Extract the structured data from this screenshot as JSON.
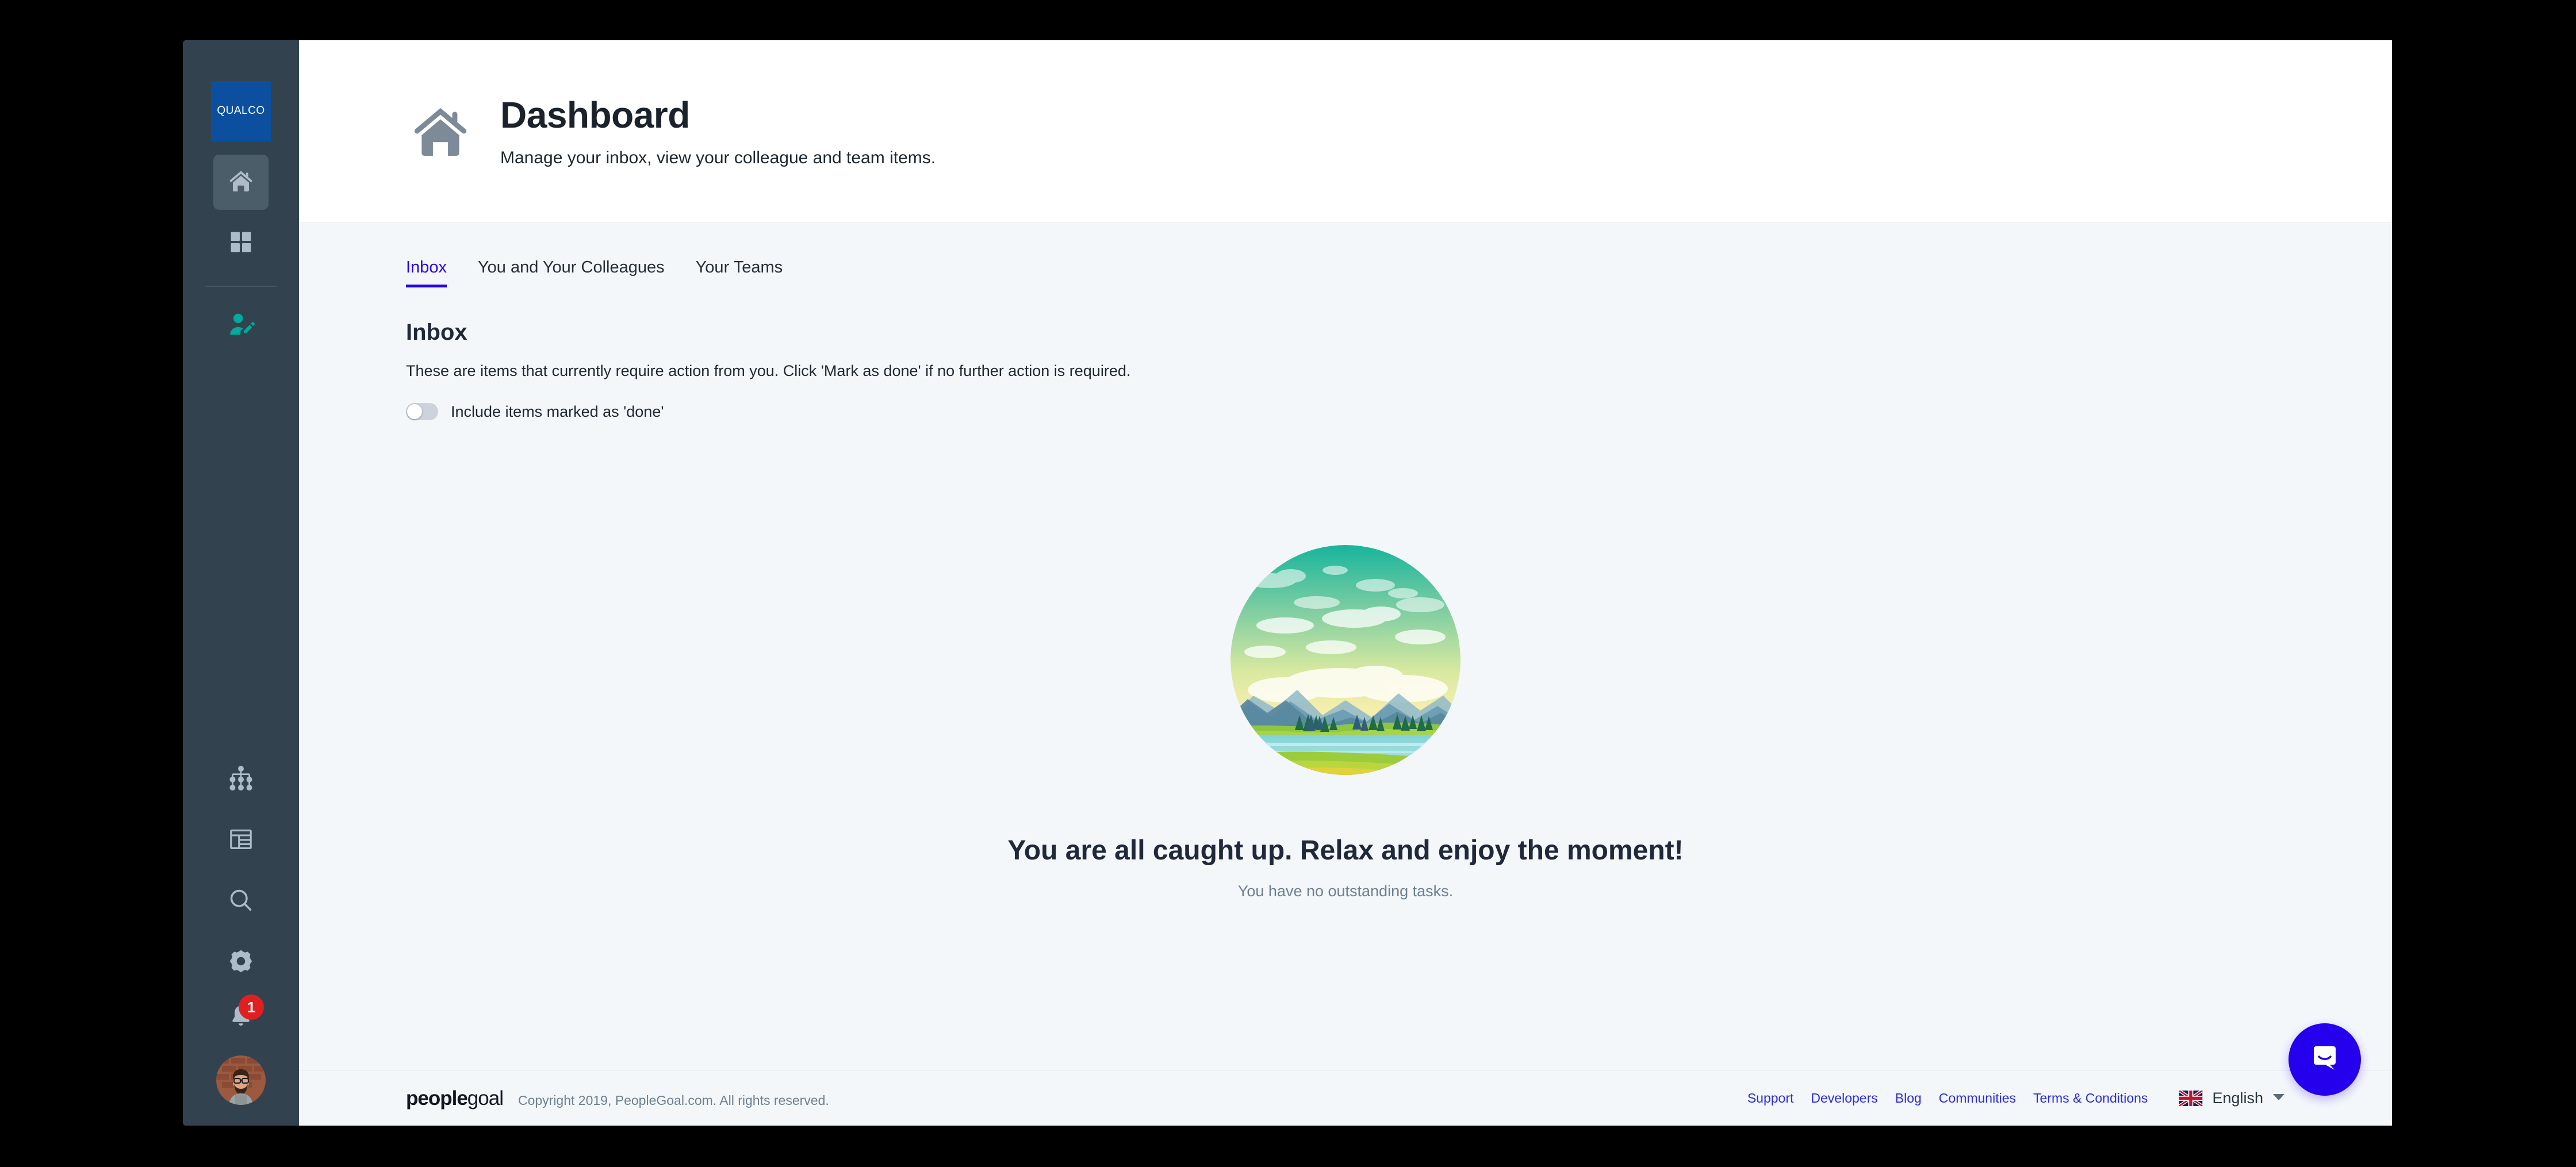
{
  "sidebar": {
    "brand": "QUALCO",
    "items": [
      {
        "name": "home",
        "icon": "home-icon",
        "active": true
      },
      {
        "name": "apps",
        "icon": "grid-icon",
        "active": false
      },
      {
        "name": "profile-edit",
        "icon": "user-edit-icon",
        "active": false
      },
      {
        "name": "org-chart",
        "icon": "org-chart-icon",
        "active": false
      },
      {
        "name": "reports",
        "icon": "table-icon",
        "active": false
      },
      {
        "name": "search",
        "icon": "search-icon",
        "active": false
      },
      {
        "name": "settings",
        "icon": "gear-icon",
        "active": false
      }
    ],
    "notifications": {
      "icon": "bell-icon",
      "count": "1"
    },
    "avatar": {
      "icon": "avatar"
    }
  },
  "header": {
    "icon": "home-icon",
    "title": "Dashboard",
    "subtitle": "Manage your inbox, view your colleague and team items."
  },
  "tabs": [
    {
      "label": "Inbox",
      "active": true
    },
    {
      "label": "You and Your Colleagues",
      "active": false
    },
    {
      "label": "Your Teams",
      "active": false
    }
  ],
  "inbox": {
    "title": "Inbox",
    "description": "These are items that currently require action from you. Click 'Mark as done' if no further action is required.",
    "toggle": {
      "label": "Include items marked as 'done'",
      "checked": false
    }
  },
  "empty_state": {
    "illustration": "landscape-illustration",
    "title": "You are all caught up. Relax and enjoy the moment!",
    "subtitle": "You have no outstanding tasks."
  },
  "footer": {
    "logo_bold": "people",
    "logo_light": "goal",
    "copyright": "Copyright 2019, PeopleGoal.com. All rights reserved.",
    "links": [
      "Support",
      "Developers",
      "Blog",
      "Communities",
      "Terms & Conditions"
    ],
    "language": {
      "flag": "uk-flag-icon",
      "label": "English",
      "chevron": "chevron-down-icon"
    }
  },
  "chat_widget": {
    "icon": "intercom-chat-icon"
  },
  "colors": {
    "sidebar_bg": "#32434f",
    "brand_blue": "#0b4f9e",
    "accent_teal": "#00ab9e",
    "accent_indigo": "#2400ec",
    "badge_red": "#e02020",
    "page_bg": "#f4f7fa"
  }
}
